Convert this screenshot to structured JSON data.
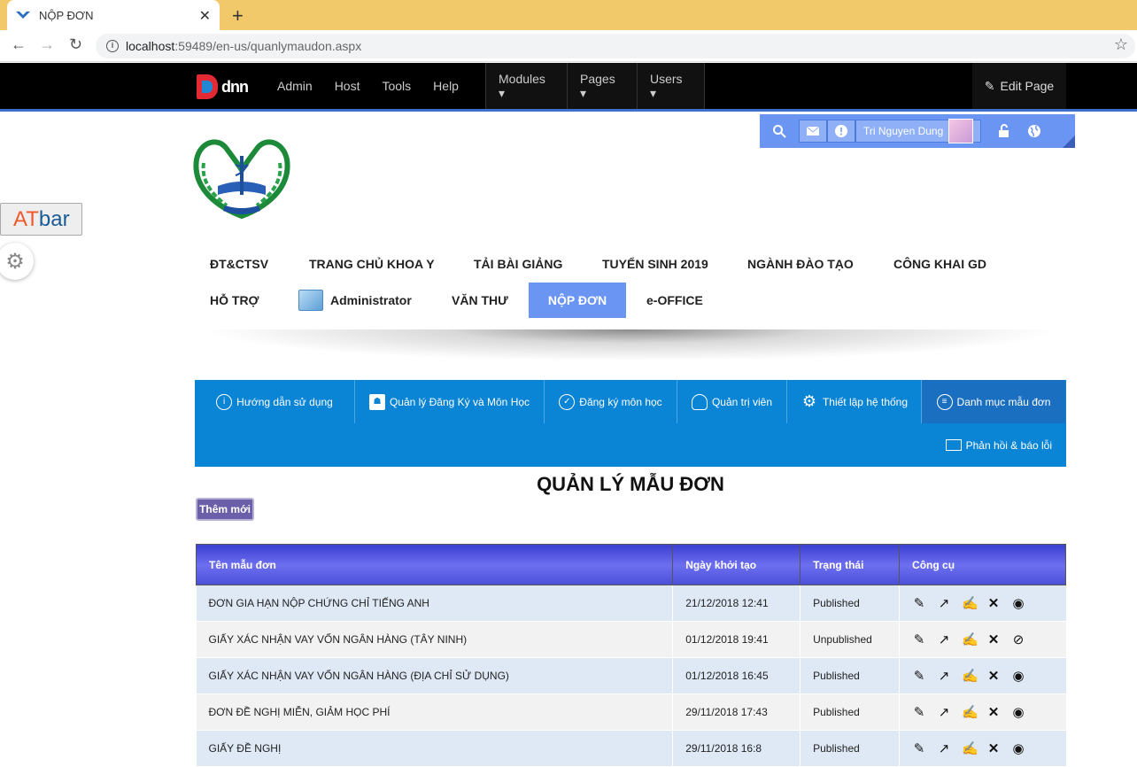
{
  "browser": {
    "tab_title": "NỘP ĐƠN",
    "tab_close": "✕",
    "new_tab": "+",
    "url_host": "localhost",
    "url_path": ":59489/en-us/quanlymaudon.aspx"
  },
  "dnn": {
    "logo_text": "dnn",
    "menu": [
      "Admin",
      "Host",
      "Tools",
      "Help"
    ],
    "dropdowns": [
      "Modules ▾",
      "Pages ▾",
      "Users ▾"
    ],
    "edit_page": "Edit Page",
    "user_name": "Tri Nguyen Dung"
  },
  "side": {
    "atbar_a": "AT",
    "atbar_b": "bar"
  },
  "main_menu": {
    "row1": [
      "ĐT&CTSV",
      "TRANG CHỦ KHOA Y",
      "TẢI BÀI GIẢNG",
      "TUYỂN SINH 2019",
      "NGÀNH ĐÀO TẠO",
      "CÔNG KHAI GD"
    ],
    "row2": [
      "HỖ TRỢ",
      "Administrator",
      "VĂN THƯ",
      "NỘP ĐƠN",
      "e-OFFICE"
    ]
  },
  "module_nav": {
    "items": [
      "Hướng dẫn sử dụng",
      "Quản lý Đăng Ký và Môn Học",
      "Đăng ký môn học",
      "Quản trị viên",
      "Thiết lập hệ thống",
      "Danh mục mẫu đơn"
    ],
    "feedback": "Phản hồi & báo lỗi"
  },
  "page": {
    "title": "QUẢN LÝ MẪU ĐƠN",
    "add_button": "Thêm mới"
  },
  "table": {
    "headers": [
      "Tên mẫu đơn",
      "Ngày khởi tạo",
      "Trạng thái",
      "Công cụ"
    ],
    "rows": [
      {
        "name": "ĐƠN GIA HẠN NỘP CHỨNG CHỈ TIẾNG ANH",
        "date": "21/12/2018 12:41",
        "status": "Published"
      },
      {
        "name": "GIẤY XÁC NHẬN VAY VỐN NGÂN HÀNG (TÂY NINH)",
        "date": "01/12/2018 19:41",
        "status": "Unpublished"
      },
      {
        "name": "GIẤY XÁC NHẬN VAY VỐN NGÂN HÀNG (ĐỊA CHỈ SỬ DỤNG)",
        "date": "01/12/2018 16:45",
        "status": "Published"
      },
      {
        "name": "ĐƠN ĐỀ NGHỊ MIỄN, GIẢM HỌC PHÍ",
        "date": "29/11/2018 17:43",
        "status": "Published"
      },
      {
        "name": "GIẤY ĐỀ NGHỊ",
        "date": "29/11/2018 16:8",
        "status": "Published"
      }
    ]
  },
  "colors": {
    "accent": "#6b95f2",
    "module_nav": "#0a84d4",
    "published": "#2a8a2a",
    "unpublished": "#d42a2a"
  }
}
